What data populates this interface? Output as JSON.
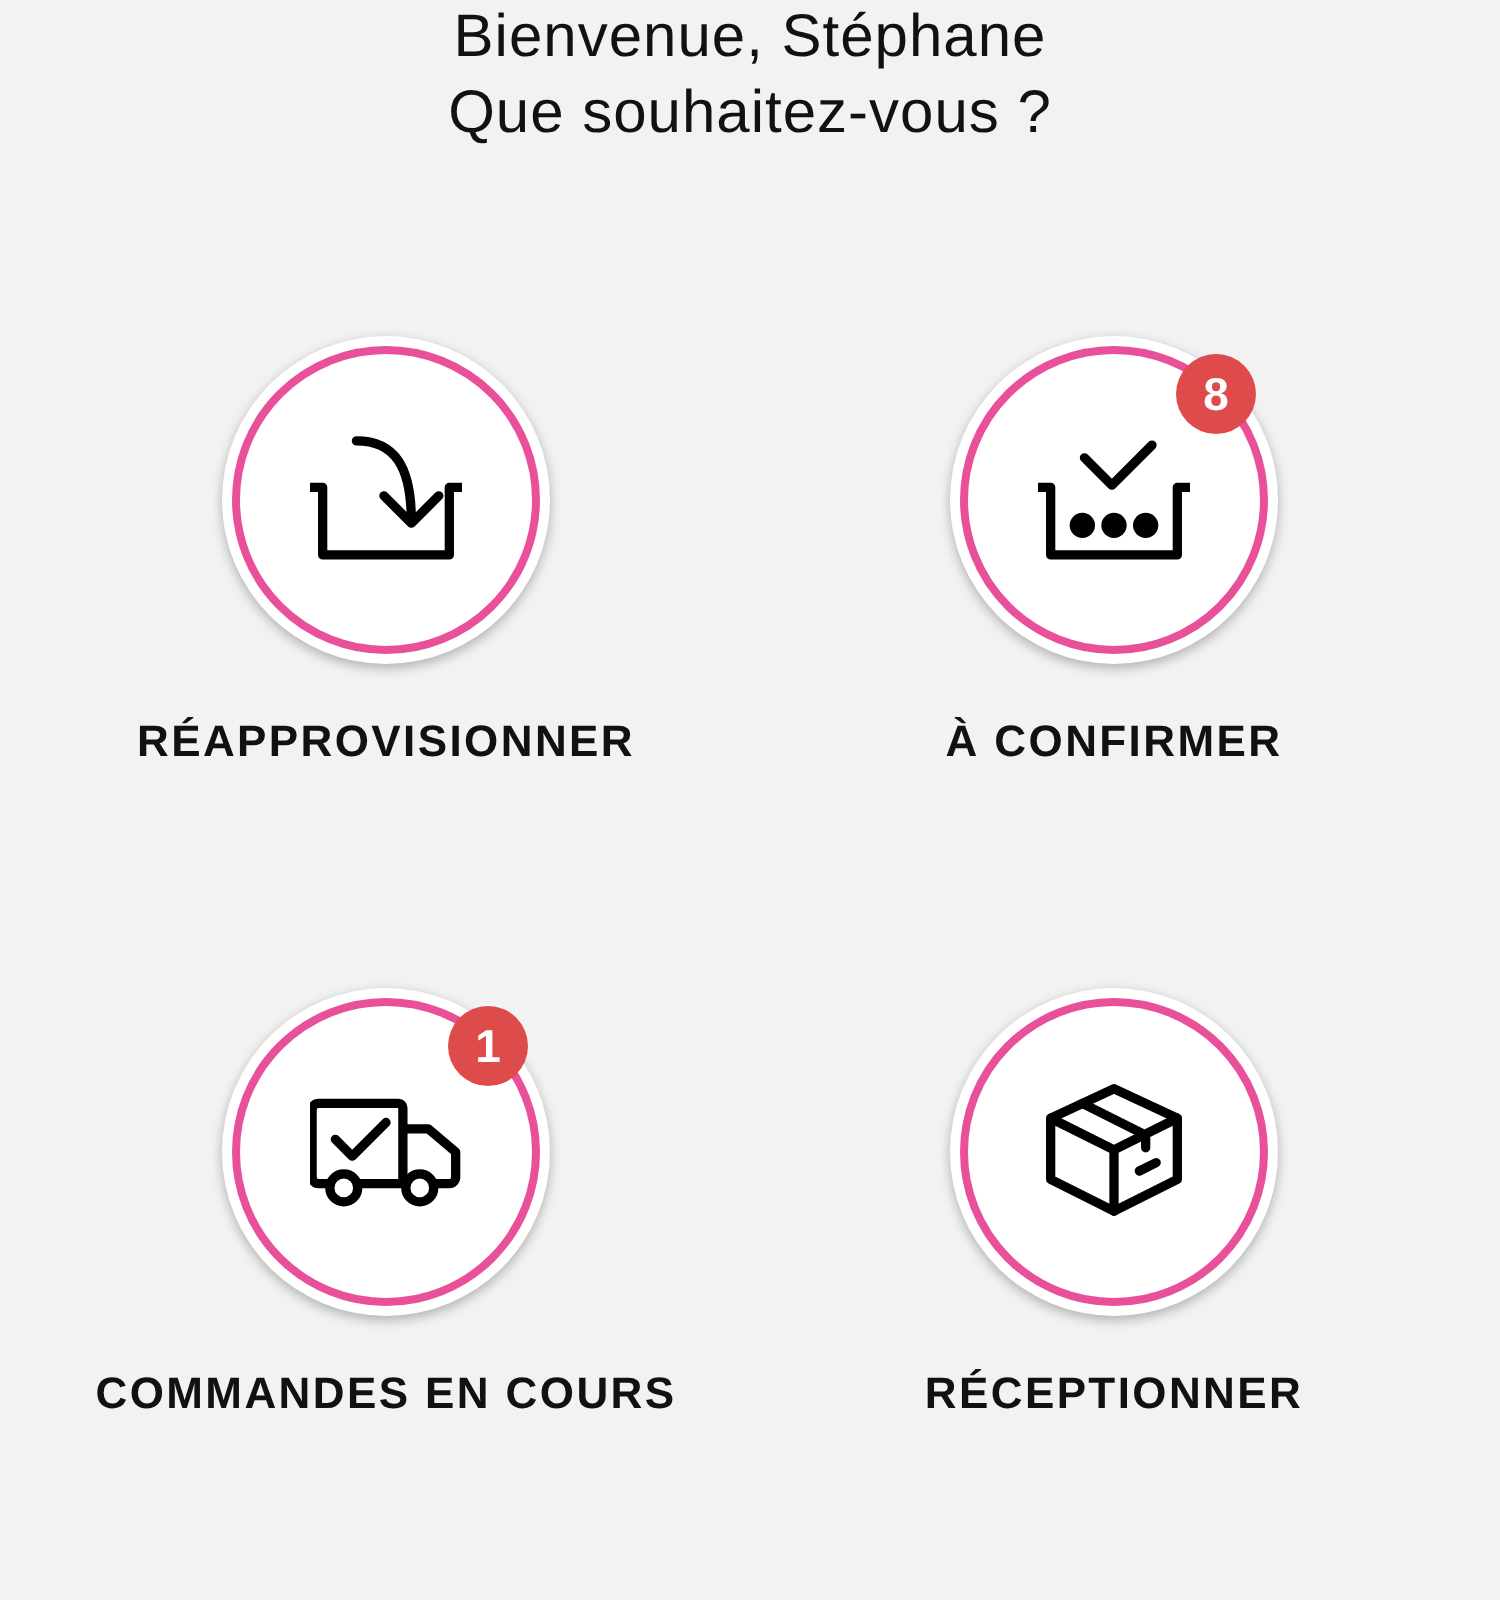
{
  "greeting": [
    "Bienvenue, Stéphane",
    "Que souhaitez-vous ?"
  ],
  "tiles": [
    {
      "label": "RÉAPPROVISIONNER"
    },
    {
      "label": "À CONFIRMER",
      "badge": "8"
    },
    {
      "label": "COMMANDES EN COURS",
      "badge": "1"
    },
    {
      "label": "RÉCEPTIONNER"
    }
  ]
}
